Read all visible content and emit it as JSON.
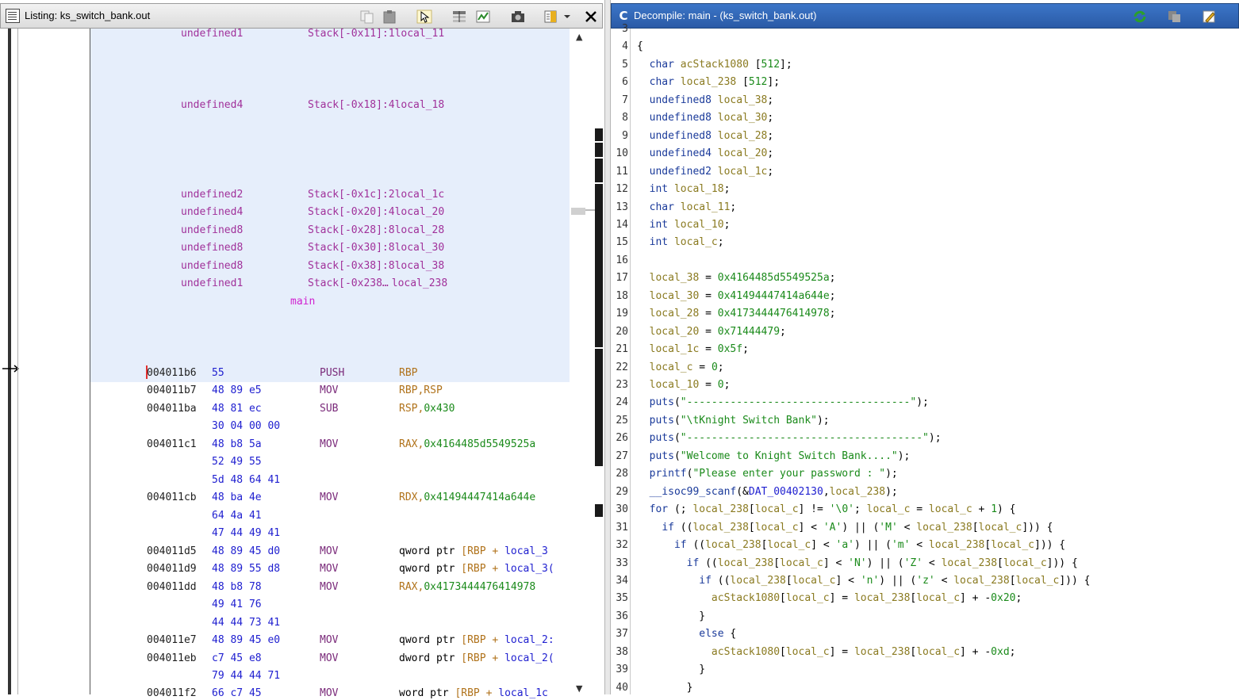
{
  "listing": {
    "title": "Listing:  ks_switch_bank.out",
    "stack_vars": [
      {
        "type": "undefined1",
        "stack": "Stack[-0x11]:1",
        "name": "local_11"
      },
      {
        "type": "undefined4",
        "stack": "Stack[-0x18]:4",
        "name": "local_18"
      },
      {
        "type": "undefined2",
        "stack": "Stack[-0x1c]:2",
        "name": "local_1c"
      },
      {
        "type": "undefined4",
        "stack": "Stack[-0x20]:4",
        "name": "local_20"
      },
      {
        "type": "undefined8",
        "stack": "Stack[-0x28]:8",
        "name": "local_28"
      },
      {
        "type": "undefined8",
        "stack": "Stack[-0x30]:8",
        "name": "local_30"
      },
      {
        "type": "undefined8",
        "stack": "Stack[-0x38]:8",
        "name": "local_38"
      },
      {
        "type": "undefined1",
        "stack": "Stack[-0x238…",
        "name": "local_238"
      }
    ],
    "function_label": "main",
    "instructions": [
      {
        "addr": "004011b6",
        "bytes": "55",
        "mnemonic": "PUSH",
        "operands": "RBP"
      },
      {
        "addr": "004011b7",
        "bytes": "48 89 e5",
        "mnemonic": "MOV",
        "operands": "RBP,RSP"
      },
      {
        "addr": "004011ba",
        "bytes": "48 81 ec",
        "mnemonic": "SUB",
        "operands": "RSP,0x430"
      },
      {
        "addr": "",
        "bytes": "30 04 00 00",
        "mnemonic": "",
        "operands": ""
      },
      {
        "addr": "004011c1",
        "bytes": "48 b8 5a",
        "mnemonic": "MOV",
        "operands": "RAX,0x4164485d5549525a"
      },
      {
        "addr": "",
        "bytes": "52 49 55",
        "mnemonic": "",
        "operands": ""
      },
      {
        "addr": "",
        "bytes": "5d 48 64 41",
        "mnemonic": "",
        "operands": ""
      },
      {
        "addr": "004011cb",
        "bytes": "48 ba 4e",
        "mnemonic": "MOV",
        "operands": "RDX,0x41494447414a644e"
      },
      {
        "addr": "",
        "bytes": "64 4a 41",
        "mnemonic": "",
        "operands": ""
      },
      {
        "addr": "",
        "bytes": "47 44 49 41",
        "mnemonic": "",
        "operands": ""
      },
      {
        "addr": "004011d5",
        "bytes": "48 89 45 d0",
        "mnemonic": "MOV",
        "operands": "qword ptr [RBP + local_3"
      },
      {
        "addr": "004011d9",
        "bytes": "48 89 55 d8",
        "mnemonic": "MOV",
        "operands": "qword ptr [RBP + local_3("
      },
      {
        "addr": "004011dd",
        "bytes": "48 b8 78",
        "mnemonic": "MOV",
        "operands": "RAX,0x4173444476414978"
      },
      {
        "addr": "",
        "bytes": "49 41 76",
        "mnemonic": "",
        "operands": ""
      },
      {
        "addr": "",
        "bytes": "44 44 73 41",
        "mnemonic": "",
        "operands": ""
      },
      {
        "addr": "004011e7",
        "bytes": "48 89 45 e0",
        "mnemonic": "MOV",
        "operands": "qword ptr [RBP + local_2:"
      },
      {
        "addr": "004011eb",
        "bytes": "c7 45 e8",
        "mnemonic": "MOV",
        "operands": "dword ptr [RBP + local_2("
      },
      {
        "addr": "",
        "bytes": "79 44 44 71",
        "mnemonic": "",
        "operands": ""
      },
      {
        "addr": "004011f2",
        "bytes": "66 c7 45",
        "mnemonic": "MOV",
        "operands": "word ptr [RBP + local_1c"
      }
    ]
  },
  "decompile": {
    "title": "Decompile: main -  (ks_switch_bank.out)",
    "lines": [
      {
        "n": "3",
        "code": ""
      },
      {
        "n": "4",
        "code": "{"
      },
      {
        "n": "5",
        "code": "  char acStack1080 [512];"
      },
      {
        "n": "6",
        "code": "  char local_238 [512];"
      },
      {
        "n": "7",
        "code": "  undefined8 local_38;"
      },
      {
        "n": "8",
        "code": "  undefined8 local_30;"
      },
      {
        "n": "9",
        "code": "  undefined8 local_28;"
      },
      {
        "n": "10",
        "code": "  undefined4 local_20;"
      },
      {
        "n": "11",
        "code": "  undefined2 local_1c;"
      },
      {
        "n": "12",
        "code": "  int local_18;"
      },
      {
        "n": "13",
        "code": "  char local_11;"
      },
      {
        "n": "14",
        "code": "  int local_10;"
      },
      {
        "n": "15",
        "code": "  int local_c;"
      },
      {
        "n": "16",
        "code": ""
      },
      {
        "n": "17",
        "code": "  local_38 = 0x4164485d5549525a;"
      },
      {
        "n": "18",
        "code": "  local_30 = 0x41494447414a644e;"
      },
      {
        "n": "19",
        "code": "  local_28 = 0x4173444476414978;"
      },
      {
        "n": "20",
        "code": "  local_20 = 0x71444479;"
      },
      {
        "n": "21",
        "code": "  local_1c = 0x5f;"
      },
      {
        "n": "22",
        "code": "  local_c = 0;"
      },
      {
        "n": "23",
        "code": "  local_10 = 0;"
      },
      {
        "n": "24",
        "code": "  puts(\"------------------------------------\");"
      },
      {
        "n": "25",
        "code": "  puts(\"\\tKnight Switch Bank\");"
      },
      {
        "n": "26",
        "code": "  puts(\"--------------------------------------\");"
      },
      {
        "n": "27",
        "code": "  puts(\"Welcome to Knight Switch Bank....\");"
      },
      {
        "n": "28",
        "code": "  printf(\"Please enter your password : \");"
      },
      {
        "n": "29",
        "code": "  __isoc99_scanf(&DAT_00402130,local_238);"
      },
      {
        "n": "30",
        "code": "  for (; local_238[local_c] != '\\0'; local_c = local_c + 1) {"
      },
      {
        "n": "31",
        "code": "    if ((local_238[local_c] < 'A') || ('M' < local_238[local_c])) {"
      },
      {
        "n": "32",
        "code": "      if ((local_238[local_c] < 'a') || ('m' < local_238[local_c])) {"
      },
      {
        "n": "33",
        "code": "        if ((local_238[local_c] < 'N') || ('Z' < local_238[local_c])) {"
      },
      {
        "n": "34",
        "code": "          if ((local_238[local_c] < 'n') || ('z' < local_238[local_c])) {"
      },
      {
        "n": "35",
        "code": "            acStack1080[local_c] = local_238[local_c] + -0x20;"
      },
      {
        "n": "36",
        "code": "          }"
      },
      {
        "n": "37",
        "code": "          else {"
      },
      {
        "n": "38",
        "code": "            acStack1080[local_c] = local_238[local_c] + -0xd;"
      },
      {
        "n": "39",
        "code": "          }"
      },
      {
        "n": "40",
        "code": "        }"
      }
    ]
  },
  "colors": {
    "title_active": "#2a5aa6",
    "highlight": "#e6eefb",
    "keyword": "#1a3a9a",
    "variable": "#8a7a20",
    "number": "#1a8a1a"
  }
}
